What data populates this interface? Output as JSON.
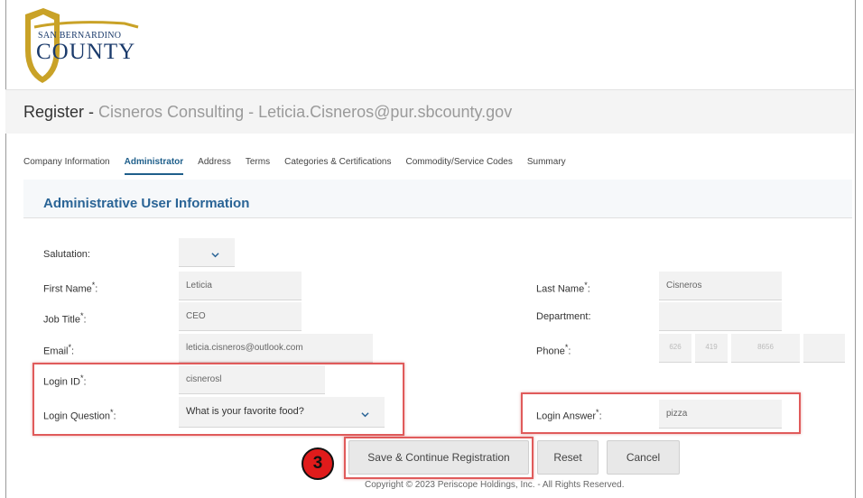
{
  "brand": {
    "line1": "SAN BERNARDINO",
    "line2": "COUNTY",
    "colors": {
      "gold": "#c9a227",
      "navy": "#1a3a6b"
    }
  },
  "header": {
    "title_prefix": "Register - ",
    "title_detail": "Cisneros Consulting - Leticia.Cisneros@pur.sbcounty.gov"
  },
  "tabs": [
    {
      "label": "Company Information",
      "active": false
    },
    {
      "label": "Administrator",
      "active": true
    },
    {
      "label": "Address",
      "active": false
    },
    {
      "label": "Terms",
      "active": false
    },
    {
      "label": "Categories & Certifications",
      "active": false
    },
    {
      "label": "Commodity/Service Codes",
      "active": false
    },
    {
      "label": "Summary",
      "active": false
    }
  ],
  "section": {
    "title": "Administrative User Information"
  },
  "form": {
    "salutation": {
      "label": "Salutation:",
      "value": ""
    },
    "first_name": {
      "label": "First Name",
      "required": "*",
      "colon": ":",
      "value": "Leticia"
    },
    "last_name": {
      "label": "Last Name",
      "required": "*",
      "colon": ":",
      "value": "Cisneros"
    },
    "job_title": {
      "label": "Job Title",
      "required": "*",
      "colon": ":",
      "value": "CEO"
    },
    "department": {
      "label": "Department:",
      "value": ""
    },
    "email": {
      "label": "Email",
      "required": "*",
      "colon": ":",
      "value": "leticia.cisneros@outlook.com"
    },
    "phone": {
      "label": "Phone",
      "required": "*",
      "colon": ":",
      "area": "626",
      "prefix": "419",
      "line": "8656",
      "ext": ""
    },
    "login_id": {
      "label": "Login ID",
      "required": "*",
      "colon": ":",
      "value": "cisnerosl"
    },
    "login_question": {
      "label": "Login Question",
      "required": "*",
      "colon": ":",
      "value": "What is your favorite food?"
    },
    "login_answer": {
      "label": "Login Answer",
      "required": "*",
      "colon": ":",
      "value": "pizza"
    }
  },
  "buttons": {
    "save": "Save & Continue Registration",
    "reset": "Reset",
    "cancel": "Cancel"
  },
  "step_badge": "3",
  "footer": {
    "copyright": "Copyright © 2023 Periscope Holdings, Inc. - All Rights Reserved."
  },
  "highlight_color": "#e05b5b"
}
